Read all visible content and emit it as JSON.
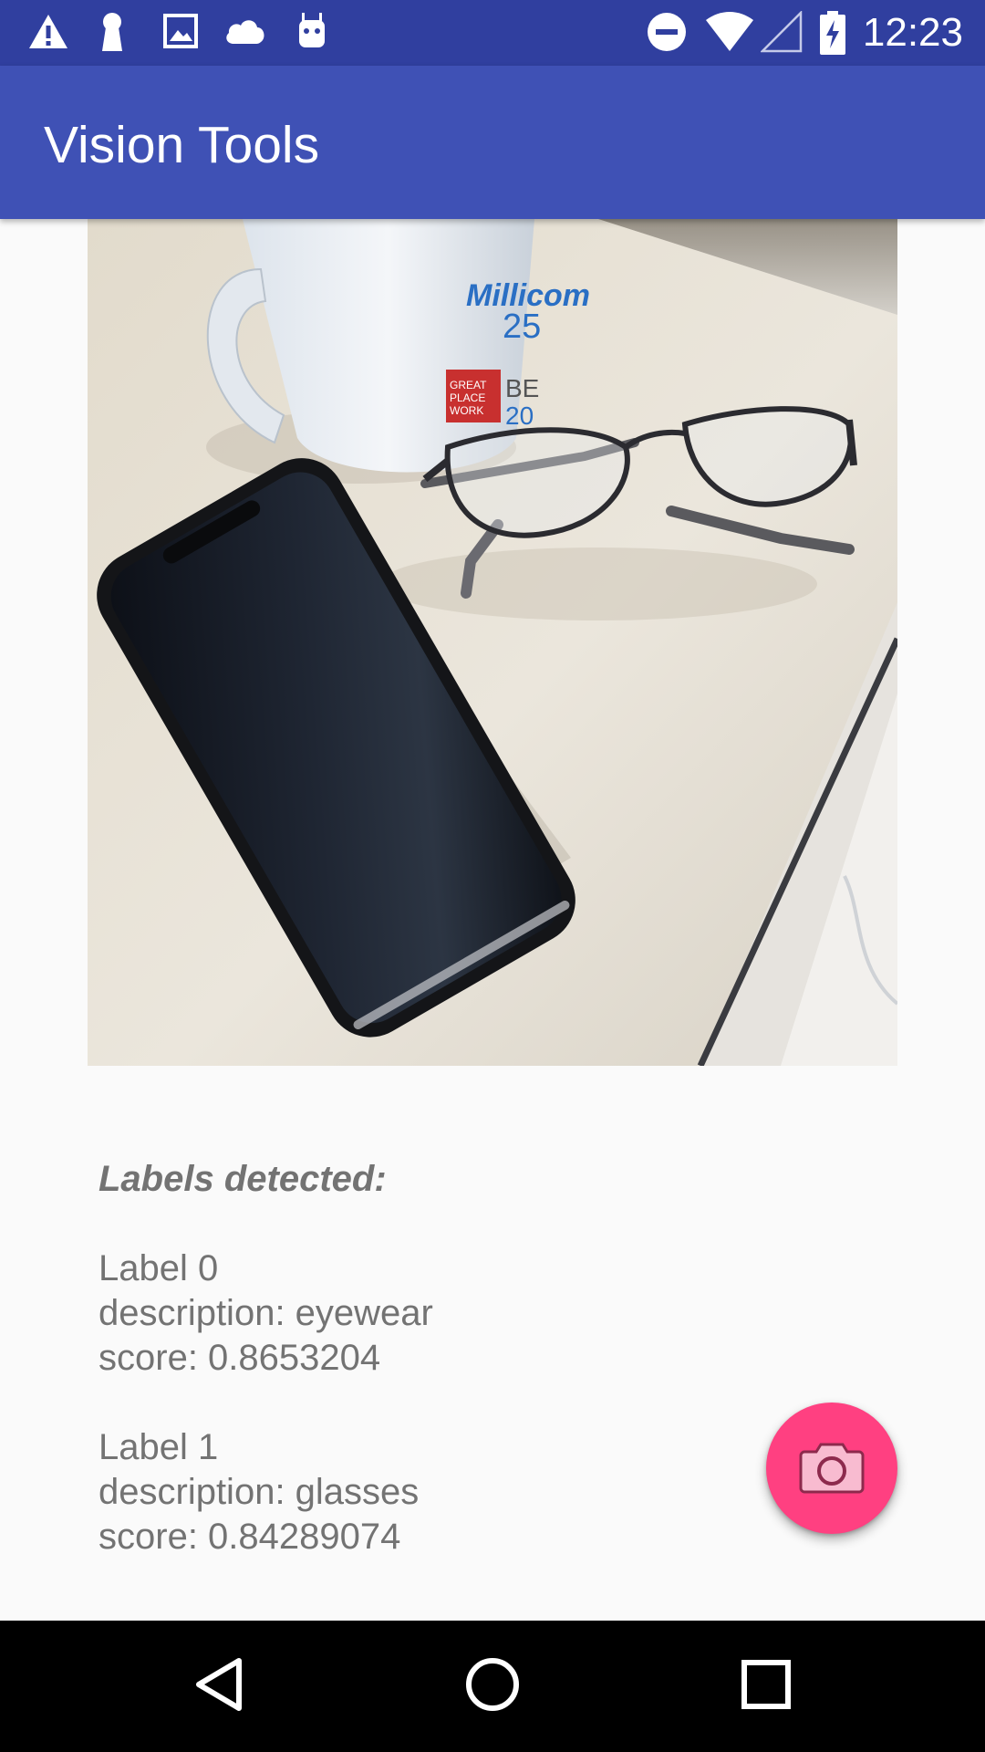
{
  "status_bar": {
    "time": "12:23",
    "icons_left": [
      "warning-icon",
      "keyhole-icon",
      "image-icon",
      "cloud-icon",
      "android-icon"
    ],
    "icons_right": [
      "do-not-disturb-icon",
      "wifi-icon",
      "signal-icon",
      "battery-charging-icon"
    ],
    "color": "#303f9f"
  },
  "app_bar": {
    "title": "Vision Tools",
    "color": "#3f51b5"
  },
  "results": {
    "heading": "Labels detected:",
    "labels": [
      {
        "title": "Label 0",
        "description": "description: eyewear",
        "score": "score: 0.8653204"
      },
      {
        "title": "Label 1",
        "description": "description: glasses",
        "score": "score: 0.84289074"
      }
    ]
  },
  "fab": {
    "icon": "camera-icon",
    "color": "#ff4081"
  },
  "nav_bar": {
    "buttons": [
      "back-icon",
      "home-icon",
      "recents-icon"
    ]
  }
}
